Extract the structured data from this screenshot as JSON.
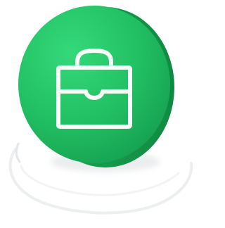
{
  "illustration": {
    "icon": "briefcase-icon",
    "coin_color": "#22c063",
    "coin_edge_color": "#15a04e",
    "icon_stroke_color": "#ffffff",
    "ring_color": "#ecedef"
  }
}
